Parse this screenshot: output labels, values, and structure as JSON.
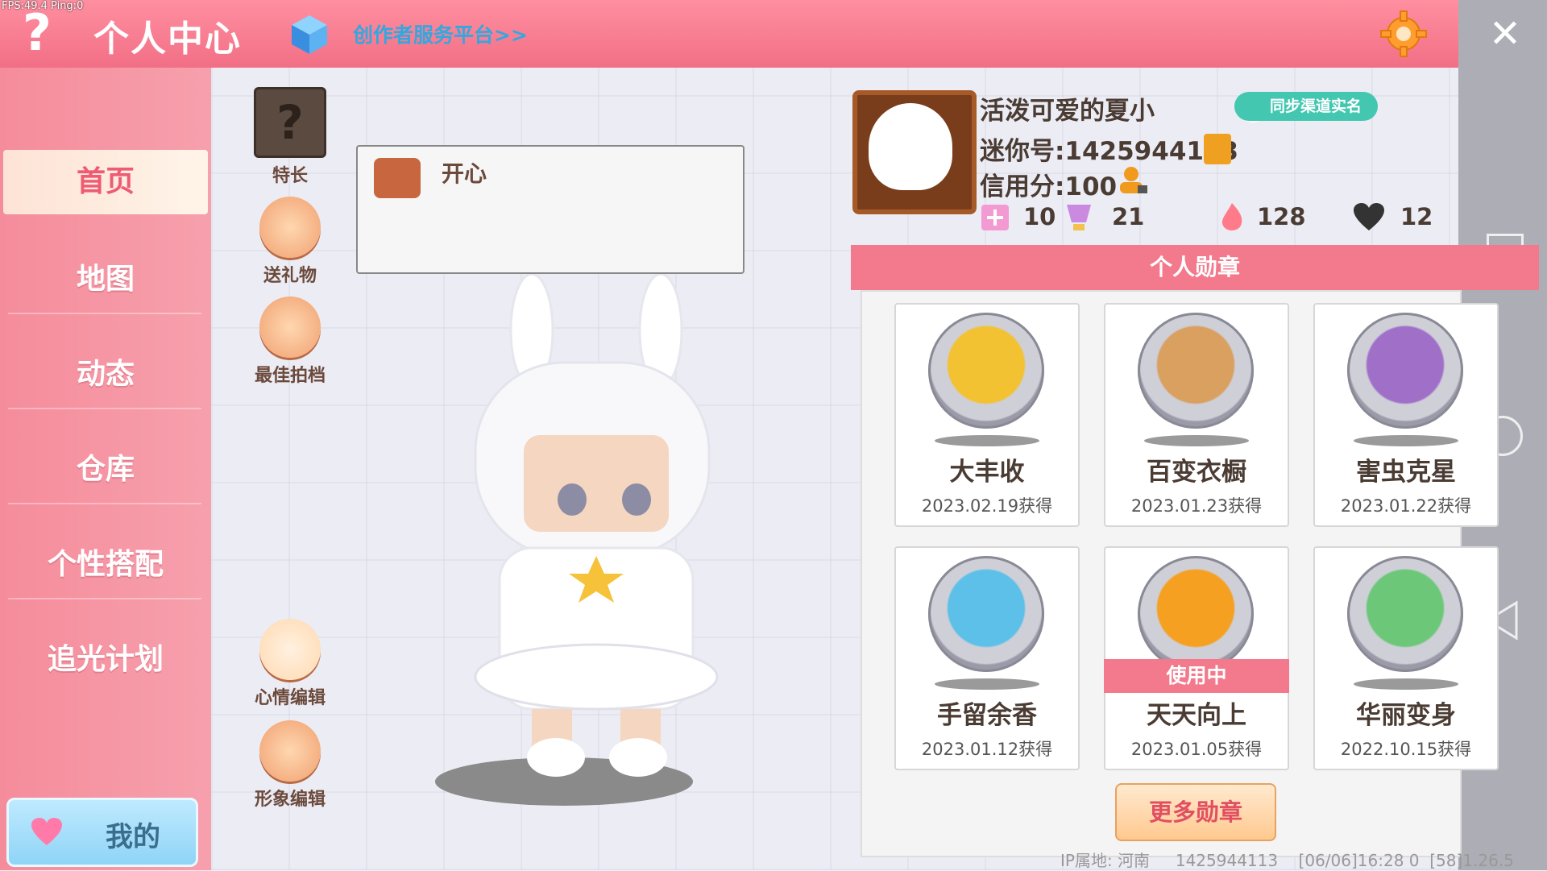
{
  "debug": {
    "fps_text": "FPS:49.4  Ping:0"
  },
  "header": {
    "help_symbol": "?",
    "title": "个人中心",
    "creator_link": "创作者服务平台>>",
    "close_symbol": "✕",
    "icons": [
      "help-icon",
      "cube-icon",
      "gear-icon",
      "close-icon"
    ]
  },
  "sidebar": {
    "items": [
      {
        "label": "首页",
        "active": true
      },
      {
        "label": "地图",
        "active": false
      },
      {
        "label": "动态",
        "active": false
      },
      {
        "label": "仓库",
        "active": false
      },
      {
        "label": "个性搭配",
        "active": false
      },
      {
        "label": "追光计划",
        "active": false
      }
    ],
    "mine_label": "我的"
  },
  "tools": {
    "skill_symbol": "?",
    "skill": "特长",
    "gift": "送礼物",
    "best_photo": "最佳拍档",
    "mood_edit": "心情编辑",
    "avatar_edit": "形象编辑"
  },
  "mood": {
    "text": "开心"
  },
  "profile": {
    "nickname": "活泼可爱的夏小",
    "sync_label": "同步渠道实名",
    "mini_id": "迷你号:1425944113",
    "credit": "信用分:100",
    "stats": {
      "flag": "10",
      "trophy": "21",
      "fire": "128",
      "heart": "12"
    }
  },
  "medals": {
    "header": "个人勋章",
    "items": [
      {
        "name": "大丰收",
        "date": "2023.02.19获得",
        "in_use": false,
        "color": "#f2c232"
      },
      {
        "name": "百变衣橱",
        "date": "2023.01.23获得",
        "in_use": false,
        "color": "#d9a060"
      },
      {
        "name": "害虫克星",
        "date": "2023.01.22获得",
        "in_use": false,
        "color": "#a070c8"
      },
      {
        "name": "手留余香",
        "date": "2023.01.12获得",
        "in_use": false,
        "color": "#5cc0e8"
      },
      {
        "name": "天天向上",
        "date": "2023.01.05获得",
        "in_use": true,
        "in_use_label": "使用中",
        "color": "#f5a020"
      },
      {
        "name": "华丽变身",
        "date": "2022.10.15获得",
        "in_use": false,
        "color": "#6cc878"
      }
    ],
    "more_label": "更多勋章"
  },
  "footer": {
    "ip": "IP属地: 河南",
    "id": "1425944113",
    "time": "[06/06]16:28 0",
    "version": "[58]1.26.5"
  },
  "colors": {
    "accent_pink": "#f27a8c",
    "topbar": "#f26f86",
    "sync_green": "#43c7b0",
    "creator_blue": "#31a8e0"
  }
}
